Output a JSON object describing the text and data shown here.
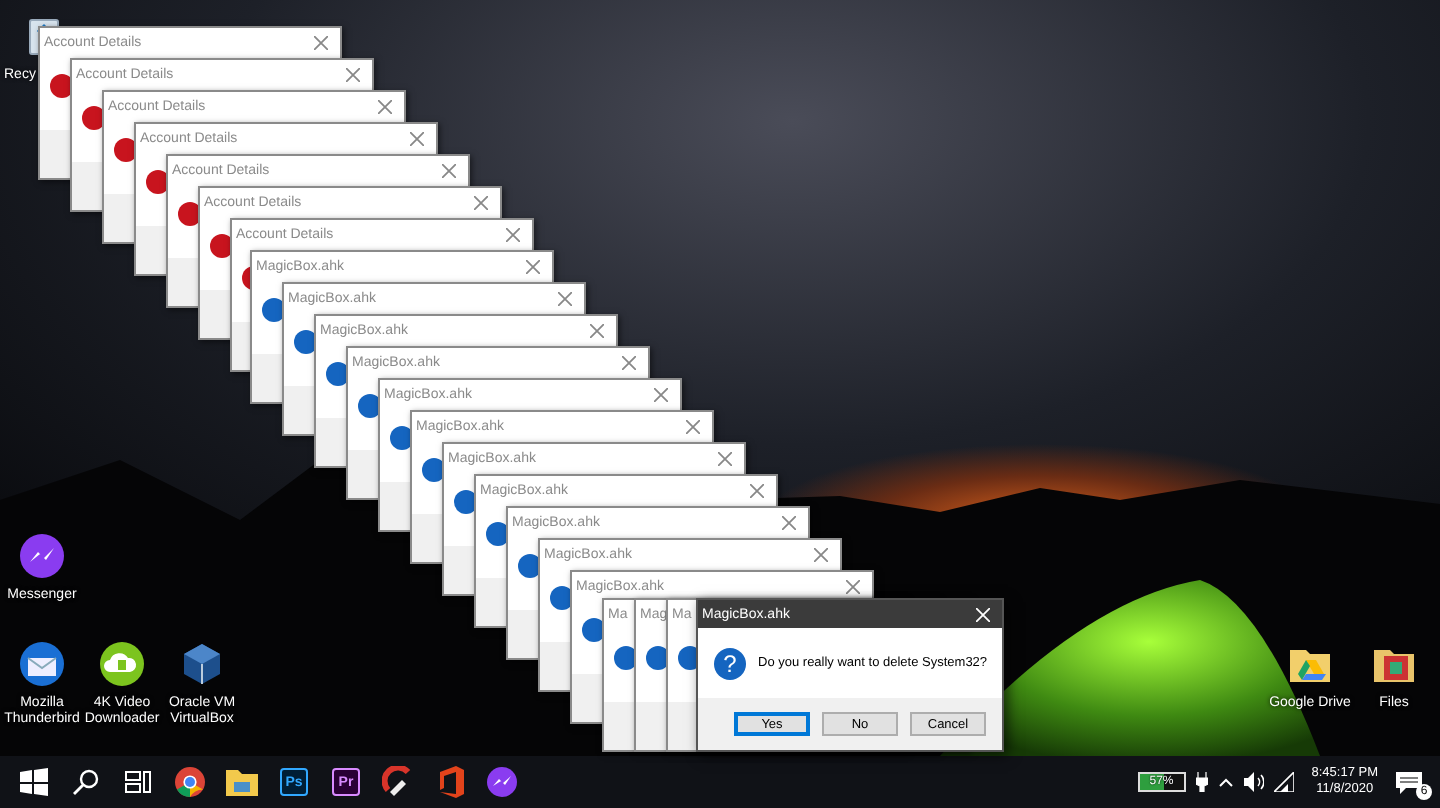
{
  "desktop_icons": [
    {
      "kind": "recycle-bin",
      "label": "Recy"
    },
    {
      "kind": "messenger",
      "label": "Messenger"
    },
    {
      "kind": "thunderbird",
      "label": "Mozilla Thunderbird"
    },
    {
      "kind": "video-downloader",
      "label": "4K Video Downloader"
    },
    {
      "kind": "virtualbox",
      "label": "Oracle VM VirtualBox"
    },
    {
      "kind": "drive-folder",
      "label": "Google Drive"
    },
    {
      "kind": "photo-folder",
      "label": "Files"
    }
  ],
  "windows": [
    {
      "title": "Account Details",
      "kind": "error",
      "close": true
    },
    {
      "title": "Account Details",
      "kind": "error",
      "close": true
    },
    {
      "title": "Account Details",
      "kind": "error",
      "close": true
    },
    {
      "title": "Account Details",
      "kind": "error",
      "close": true
    },
    {
      "title": "Account Details",
      "kind": "error",
      "close": true
    },
    {
      "title": "Account Details",
      "kind": "error",
      "close": true
    },
    {
      "title": "Account Details",
      "kind": "error",
      "close": true
    },
    {
      "title": "MagicBox.ahk",
      "kind": "question",
      "close": true
    },
    {
      "title": "MagicBox.ahk",
      "kind": "question",
      "close": true
    },
    {
      "title": "MagicBox.ahk",
      "kind": "question",
      "close": true
    },
    {
      "title": "MagicBox.ahk",
      "kind": "question",
      "close": true
    },
    {
      "title": "MagicBox.ahk",
      "kind": "question",
      "close": true
    },
    {
      "title": "MagicBox.ahk",
      "kind": "question",
      "close": true
    },
    {
      "title": "MagicBox.ahk",
      "kind": "question",
      "close": true
    },
    {
      "title": "MagicBox.ahk",
      "kind": "question",
      "close": true
    },
    {
      "title": "MagicBox.ahk",
      "kind": "question",
      "close": true
    },
    {
      "title": "MagicBox.ahk",
      "kind": "question",
      "close": true
    },
    {
      "title": "MagicBox.ahk",
      "kind": "question",
      "close": true
    },
    {
      "title": "Ma",
      "kind": "question",
      "close": false
    },
    {
      "title": "Mag",
      "kind": "question",
      "close": false
    },
    {
      "title": "Ma",
      "kind": "question",
      "close": false
    }
  ],
  "dialog": {
    "title": "MagicBox.ahk",
    "icon_glyph": "?",
    "message": "Do you really want to delete System32?",
    "buttons": [
      {
        "label": "Yes",
        "selected": true
      },
      {
        "label": "No",
        "selected": false
      },
      {
        "label": "Cancel",
        "selected": false
      }
    ]
  },
  "taskbar": {
    "apps": [
      {
        "kind": "start"
      },
      {
        "kind": "search"
      },
      {
        "kind": "task-view"
      },
      {
        "kind": "chrome"
      },
      {
        "kind": "explorer"
      },
      {
        "kind": "ps",
        "text": "Ps"
      },
      {
        "kind": "pr",
        "text": "Pr"
      },
      {
        "kind": "ccleaner"
      },
      {
        "kind": "office"
      },
      {
        "kind": "messenger"
      }
    ],
    "tray": {
      "battery": {
        "level": 0.57,
        "reading": "57%"
      },
      "time": "8:45:17 PM",
      "date": "11/8/2020",
      "notifications": "6"
    }
  }
}
